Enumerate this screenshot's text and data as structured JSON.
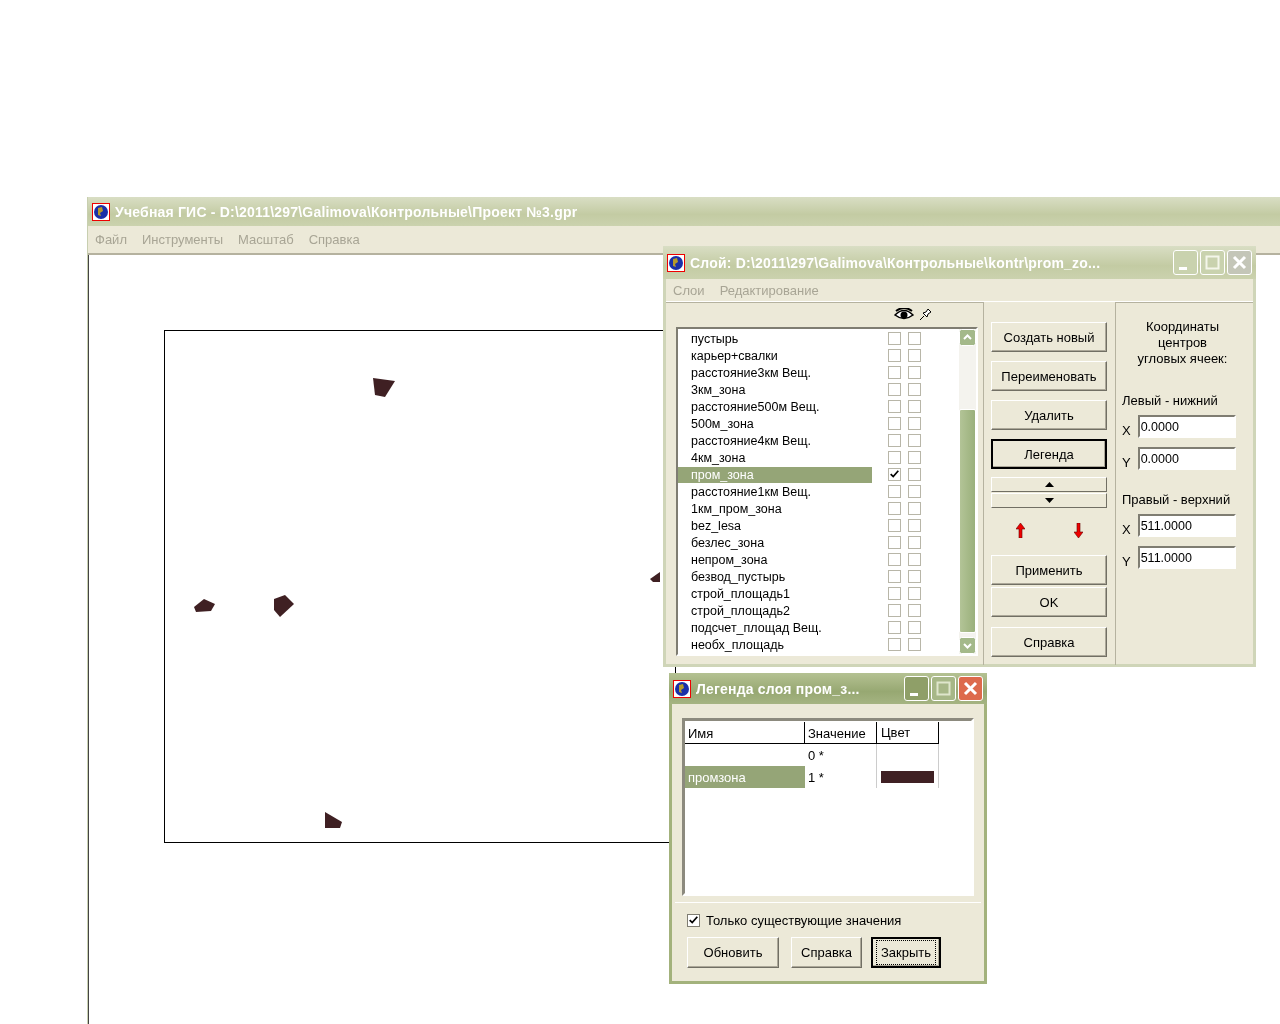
{
  "main_window": {
    "title": "Учебная ГИС - D:\\2011\\297\\Galimova\\Контрольные\\Проект №3.gpr",
    "menu": [
      "Файл",
      "Инструменты",
      "Масштаб",
      "Справка"
    ]
  },
  "layer_dialog": {
    "title": "Слой: D:\\2011\\297\\Galimova\\Контрольные\\kontr\\prom_zo...",
    "menu": [
      "Слои",
      "Редактирование"
    ],
    "layers": [
      {
        "name": "пустырь",
        "selected": false,
        "visible": false,
        "pinned": false
      },
      {
        "name": "карьер+свалки",
        "selected": false,
        "visible": false,
        "pinned": false
      },
      {
        "name": "расстояние3км Вещ.",
        "selected": false,
        "visible": false,
        "pinned": false
      },
      {
        "name": "3км_зона",
        "selected": false,
        "visible": false,
        "pinned": false
      },
      {
        "name": "расстояние500м Вещ.",
        "selected": false,
        "visible": false,
        "pinned": false
      },
      {
        "name": "500м_зона",
        "selected": false,
        "visible": false,
        "pinned": false
      },
      {
        "name": "расстояние4км Вещ.",
        "selected": false,
        "visible": false,
        "pinned": false
      },
      {
        "name": "4км_зона",
        "selected": false,
        "visible": false,
        "pinned": false
      },
      {
        "name": "пром_зона",
        "selected": true,
        "visible": true,
        "pinned": false
      },
      {
        "name": "расстояние1км Вещ.",
        "selected": false,
        "visible": false,
        "pinned": false
      },
      {
        "name": "1км_пром_зона",
        "selected": false,
        "visible": false,
        "pinned": false
      },
      {
        "name": "bez_lesa",
        "selected": false,
        "visible": false,
        "pinned": false
      },
      {
        "name": "безлес_зона",
        "selected": false,
        "visible": false,
        "pinned": false
      },
      {
        "name": "непром_зона",
        "selected": false,
        "visible": false,
        "pinned": false
      },
      {
        "name": "безвод_пустырь",
        "selected": false,
        "visible": false,
        "pinned": false
      },
      {
        "name": "строй_площадь1",
        "selected": false,
        "visible": false,
        "pinned": false
      },
      {
        "name": "строй_площадь2",
        "selected": false,
        "visible": false,
        "pinned": false
      },
      {
        "name": "подсчет_площад Вещ.",
        "selected": false,
        "visible": false,
        "pinned": false
      },
      {
        "name": "необх_площадь",
        "selected": false,
        "visible": false,
        "pinned": false
      }
    ],
    "buttons_top": [
      {
        "label": "Создать новый",
        "default": false
      },
      {
        "label": "Переименовать",
        "default": false
      },
      {
        "label": "Удалить",
        "default": false
      },
      {
        "label": "Легенда",
        "default": true
      }
    ],
    "buttons_bottom": [
      "Применить",
      "OK",
      "Справка"
    ],
    "coords": {
      "heading": "Координаты центров угловых ячеек:",
      "groups": [
        {
          "label": "Левый - нижний",
          "fields": [
            {
              "axis": "X",
              "value": "0.0000"
            },
            {
              "axis": "Y",
              "value": "0.0000"
            }
          ]
        },
        {
          "label": "Правый - верхний",
          "fields": [
            {
              "axis": "X",
              "value": "511.0000"
            },
            {
              "axis": "Y",
              "value": "511.0000"
            }
          ]
        }
      ]
    }
  },
  "legend_dialog": {
    "title": "Легенда слоя пром_з...",
    "columns": [
      "Имя",
      "Значение",
      "Цвет"
    ],
    "rows": [
      {
        "name": "",
        "value": "0 *",
        "selected": false
      },
      {
        "name": "промзона",
        "value": "1 *",
        "color": "#3f2023",
        "selected": true
      }
    ],
    "only_existing": {
      "label": "Только  существующие значения",
      "checked": true
    },
    "buttons": [
      {
        "label": "Обновить",
        "focused": false
      },
      {
        "label": "Справка",
        "focused": false
      },
      {
        "label": "Закрыть",
        "focused": true
      }
    ]
  }
}
